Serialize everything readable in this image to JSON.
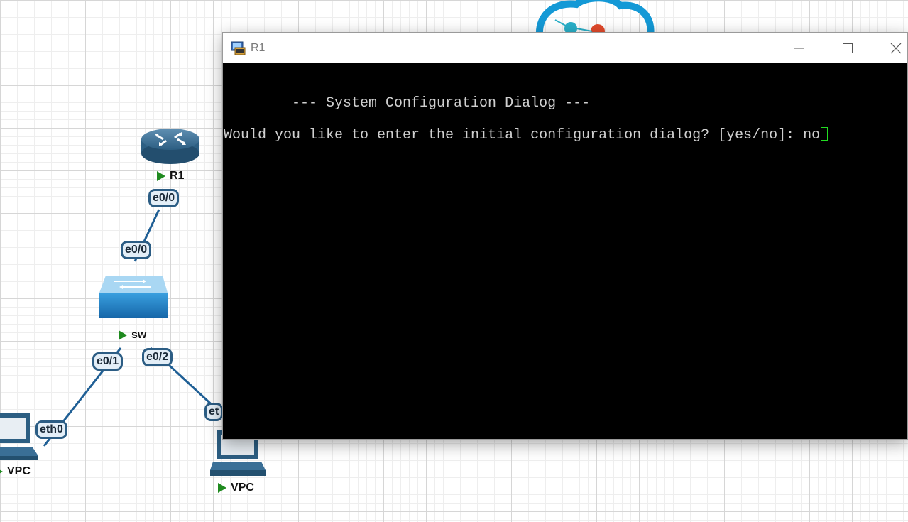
{
  "topology": {
    "nodes": [
      {
        "label": "R1",
        "type": "router"
      },
      {
        "label": "sw",
        "type": "switch"
      },
      {
        "label": "VPC",
        "type": "pc"
      },
      {
        "label": "VPC",
        "type": "pc"
      }
    ],
    "interfaces": {
      "r1_e0": "e0/0",
      "sw_e00": "e0/0",
      "sw_e01": "e0/1",
      "sw_e02": "e0/2",
      "vpc1_eth0": "eth0",
      "vpc2_eth0_partial": "et"
    },
    "colors": {
      "link": "#1f5f95",
      "running": "#1f8a1f"
    }
  },
  "window": {
    "title": "R1",
    "icons": {
      "app": "terminal-app-icon",
      "minimize": "minimize-icon",
      "maximize": "maximize-icon",
      "close": "close-icon"
    }
  },
  "terminal": {
    "line1": "        --- System Configuration Dialog ---",
    "line2": "Would you like to enter the initial configuration dialog? [yes/no]: no",
    "cursor_color": "#22dd22"
  }
}
